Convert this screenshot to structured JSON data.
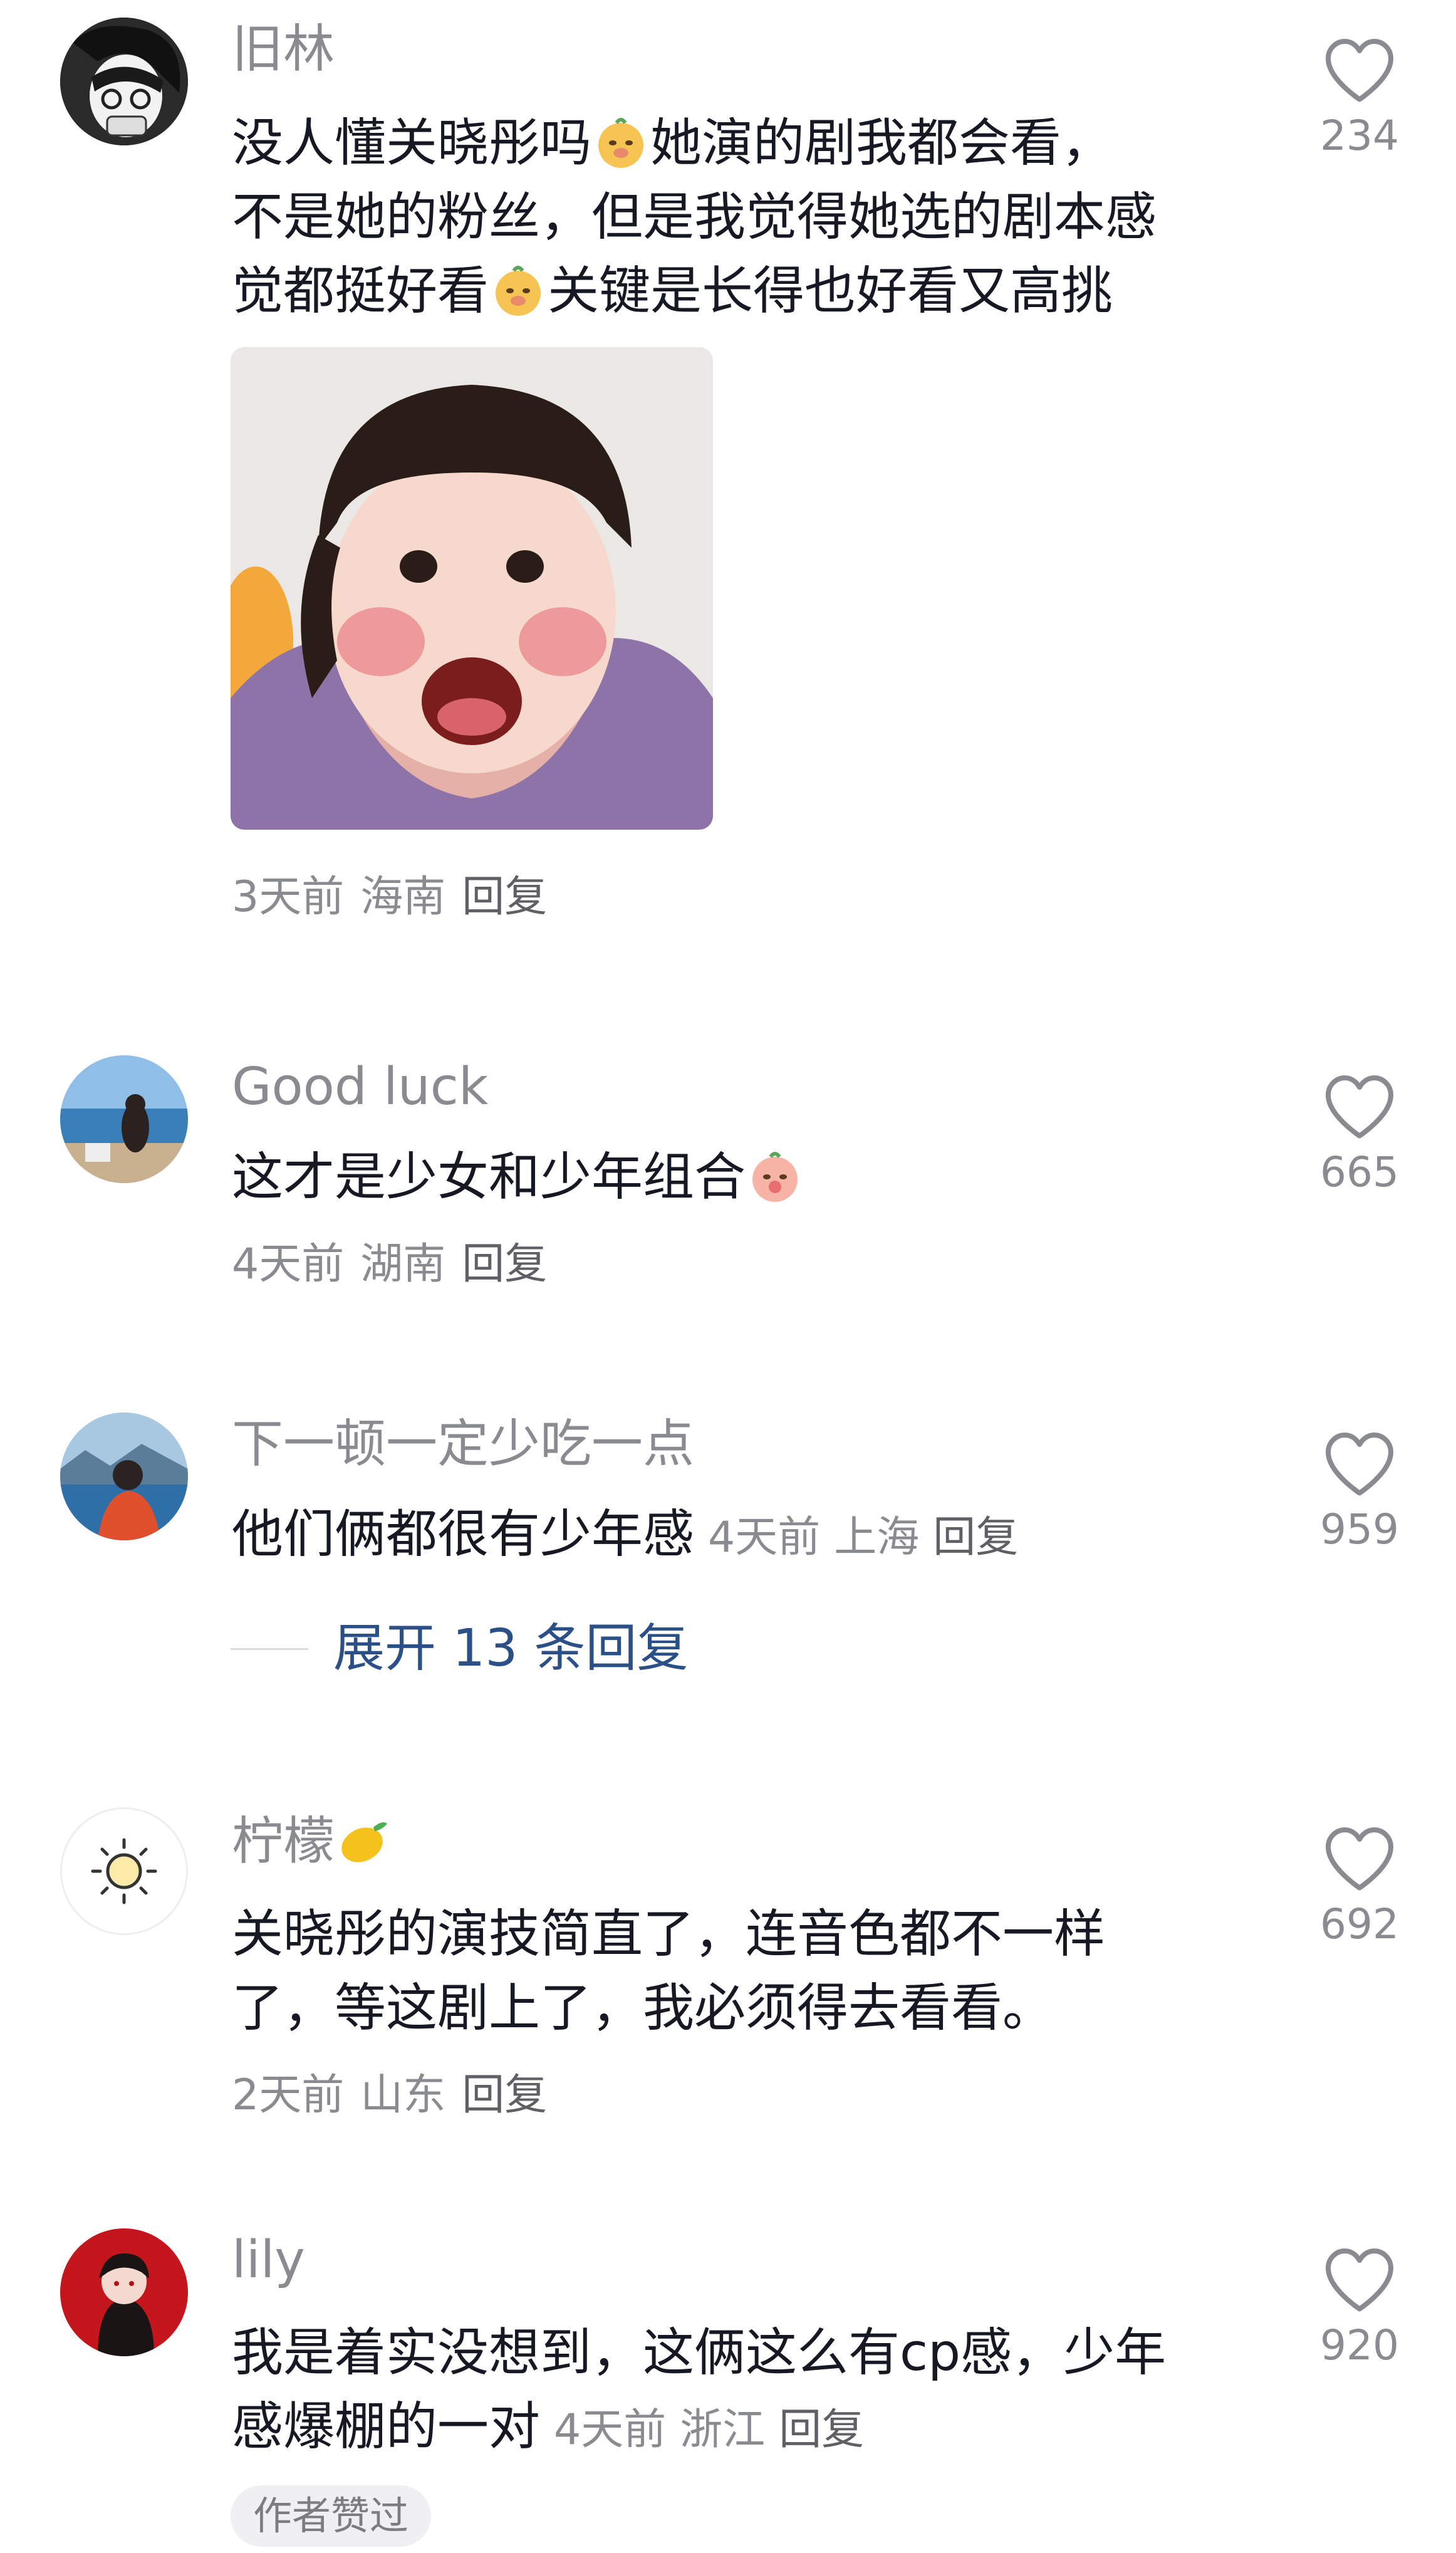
{
  "comments": [
    {
      "username": "旧林",
      "text_a": "没人懂关晓彤吗",
      "emoji_a": "smirk-pig-emoji",
      "text_b": "她演的剧我都会看，",
      "text_c": "不是她的粉丝，但是我觉得她选的剧本感",
      "text_d": "觉都挺好看",
      "emoji_b": "smirk-pig-emoji",
      "text_e": "关键是长得也好看又高挑",
      "meta_time": "3天前",
      "meta_location": "海南",
      "reply": "回复",
      "likes": "234",
      "has_image": true
    },
    {
      "username": "Good luck",
      "text_a": "这才是少女和少年组合",
      "emoji_a": "shy-peach-emoji",
      "meta_time": "4天前",
      "meta_location": "湖南",
      "reply": "回复",
      "likes": "665"
    },
    {
      "username": "下一顿一定少吃一点",
      "text_a": "他们俩都很有少年感",
      "meta_time": "4天前",
      "meta_location": "上海",
      "reply": "回复",
      "likes": "959",
      "expand_text": "展开 13 条回复"
    },
    {
      "username": "柠檬",
      "username_emoji": "lemon-emoji",
      "text_a": "关晓彤的演技简直了，连音色都不一样",
      "text_b": "了，等这剧上了，我必须得去看看。",
      "meta_time": "2天前",
      "meta_location": "山东",
      "reply": "回复",
      "likes": "692"
    },
    {
      "username": "lily",
      "text_a": "我是着实没想到，这俩这么有cp感，少年",
      "text_b": "感爆棚的一对",
      "meta_time": "4天前",
      "meta_location": "浙江",
      "reply": "回复",
      "likes": "920",
      "badge": "作者赞过"
    }
  ],
  "icons": {
    "like": "heart-outline-icon"
  },
  "colors": {
    "text": "#161823",
    "secondary": "#8a8b91",
    "expand": "#2b4f87"
  }
}
